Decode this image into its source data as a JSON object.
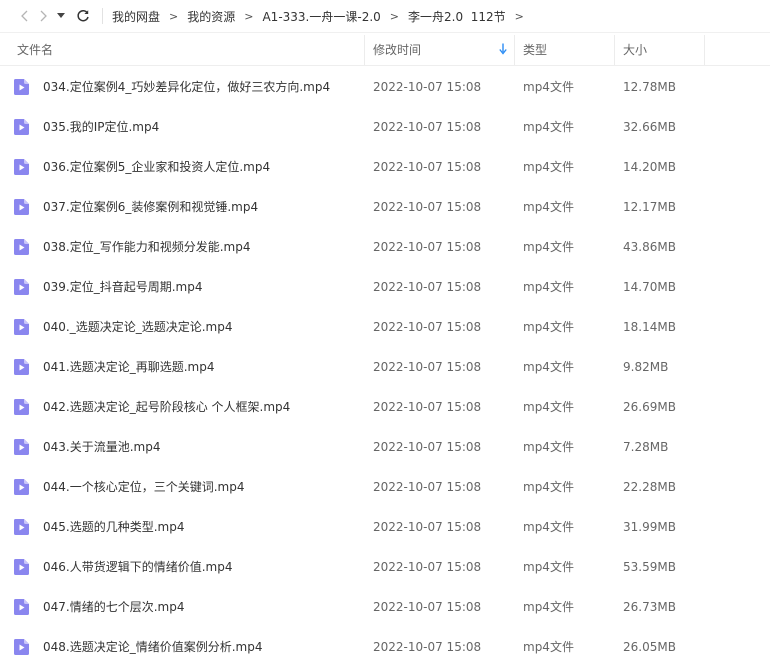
{
  "nav": {
    "back_icon": "chevron-left-icon",
    "dropdown_icon": "caret-down-icon",
    "refresh_icon": "refresh-icon"
  },
  "breadcrumb": [
    "我的网盘",
    "我的资源",
    "A1-333.一舟一课-2.0",
    "李一舟2.0  112节"
  ],
  "columns": {
    "name": "文件名",
    "modified": "修改时间",
    "type": "类型",
    "size": "大小"
  },
  "sort": {
    "column": "modified",
    "direction": "desc",
    "arrow_color": "#2a8cf4"
  },
  "colors": {
    "file_icon": "#8a86ef"
  },
  "files": [
    {
      "name": "034.定位案例4_巧妙差异化定位，做好三农方向.mp4",
      "modified": "2022-10-07 15:08",
      "type": "mp4文件",
      "size": "12.78MB"
    },
    {
      "name": "035.我的IP定位.mp4",
      "modified": "2022-10-07 15:08",
      "type": "mp4文件",
      "size": "32.66MB"
    },
    {
      "name": "036.定位案例5_企业家和投资人定位.mp4",
      "modified": "2022-10-07 15:08",
      "type": "mp4文件",
      "size": "14.20MB"
    },
    {
      "name": "037.定位案例6_装修案例和视觉锤.mp4",
      "modified": "2022-10-07 15:08",
      "type": "mp4文件",
      "size": "12.17MB"
    },
    {
      "name": "038.定位_写作能力和视频分发能.mp4",
      "modified": "2022-10-07 15:08",
      "type": "mp4文件",
      "size": "43.86MB"
    },
    {
      "name": "039.定位_抖音起号周期.mp4",
      "modified": "2022-10-07 15:08",
      "type": "mp4文件",
      "size": "14.70MB"
    },
    {
      "name": "040._选题决定论_选题决定论.mp4",
      "modified": "2022-10-07 15:08",
      "type": "mp4文件",
      "size": "18.14MB"
    },
    {
      "name": "041.选题决定论_再聊选题.mp4",
      "modified": "2022-10-07 15:08",
      "type": "mp4文件",
      "size": "9.82MB"
    },
    {
      "name": "042.选题决定论_起号阶段核心 个人框架.mp4",
      "modified": "2022-10-07 15:08",
      "type": "mp4文件",
      "size": "26.69MB"
    },
    {
      "name": "043.关于流量池.mp4",
      "modified": "2022-10-07 15:08",
      "type": "mp4文件",
      "size": "7.28MB"
    },
    {
      "name": "044.一个核心定位，三个关键词.mp4",
      "modified": "2022-10-07 15:08",
      "type": "mp4文件",
      "size": "22.28MB"
    },
    {
      "name": "045.选题的几种类型.mp4",
      "modified": "2022-10-07 15:08",
      "type": "mp4文件",
      "size": "31.99MB"
    },
    {
      "name": "046.人带货逻辑下的情绪价值.mp4",
      "modified": "2022-10-07 15:08",
      "type": "mp4文件",
      "size": "53.59MB"
    },
    {
      "name": "047.情绪的七个层次.mp4",
      "modified": "2022-10-07 15:08",
      "type": "mp4文件",
      "size": "26.73MB"
    },
    {
      "name": "048.选题决定论_情绪价值案例分析.mp4",
      "modified": "2022-10-07 15:08",
      "type": "mp4文件",
      "size": "26.05MB"
    }
  ]
}
